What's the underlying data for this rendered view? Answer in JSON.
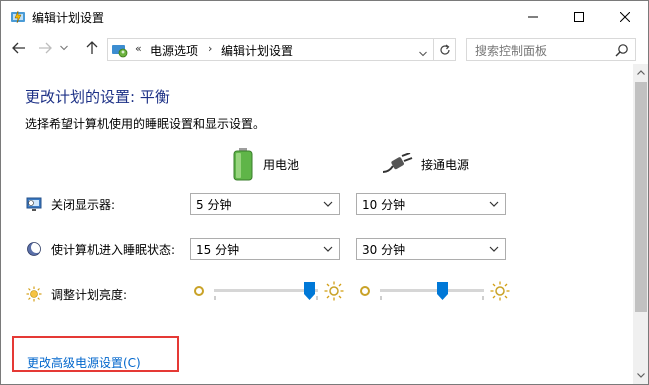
{
  "window": {
    "title": "编辑计划设置",
    "icon": "power-options-icon"
  },
  "address_bar": {
    "chevron": "«",
    "crumbs": [
      "电源选项",
      "编辑计划设置"
    ],
    "separator": "›",
    "search_placeholder": "搜索控制面板"
  },
  "content": {
    "heading": "更改计划的设置: 平衡",
    "subtext": "选择希望计算机使用的睡眠设置和显示设置。",
    "columns": {
      "battery": "用电池",
      "plugged": "接通电源"
    },
    "rows": {
      "display_off": {
        "label": "关闭显示器:",
        "battery_value": "5 分钟",
        "plugged_value": "10 分钟"
      },
      "sleep": {
        "label": "使计算机进入睡眠状态:",
        "battery_value": "15 分钟",
        "plugged_value": "30 分钟"
      },
      "brightness": {
        "label": "调整计划亮度:",
        "battery_level": 0.92,
        "plugged_level": 0.6
      }
    },
    "advanced_link": "更改高级电源设置(C)"
  },
  "colors": {
    "heading": "#1e3287",
    "link": "#0066cc",
    "highlight": "#e53935",
    "slider_thumb": "#0078d7"
  }
}
